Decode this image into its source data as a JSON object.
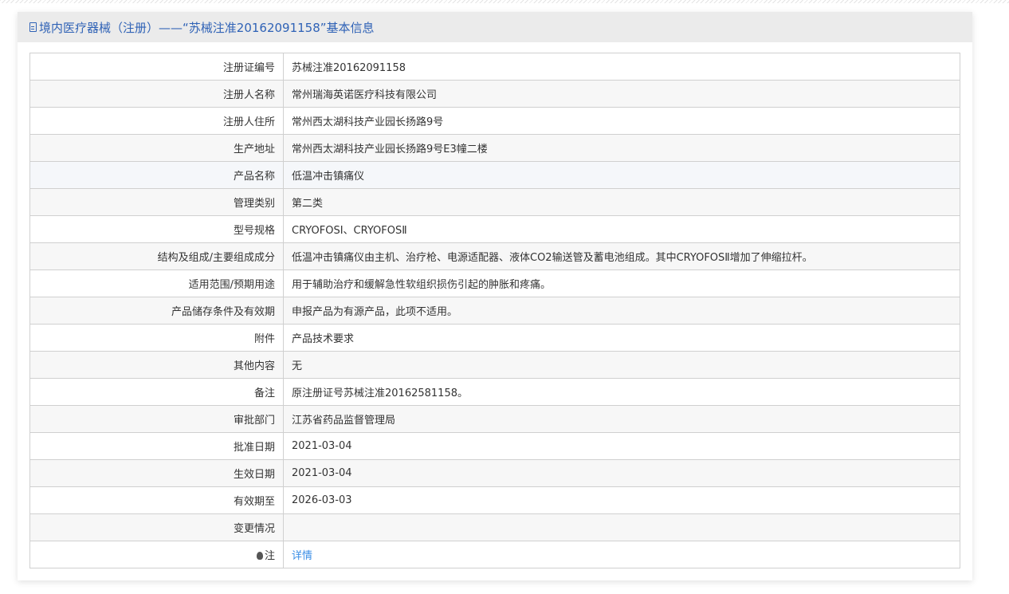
{
  "header": {
    "title": "境内医疗器械（注册）——“苏械注准20162091158”基本信息"
  },
  "rows": [
    {
      "label": "注册证编号",
      "value": "苏械注准20162091158"
    },
    {
      "label": "注册人名称",
      "value": "常州瑞海英诺医疗科技有限公司"
    },
    {
      "label": "注册人住所",
      "value": "常州西太湖科技产业园长扬路9号"
    },
    {
      "label": "生产地址",
      "value": "常州西太湖科技产业园长扬路9号E3幢二楼"
    },
    {
      "label": "产品名称",
      "value": "低温冲击镇痛仪"
    },
    {
      "label": "管理类别",
      "value": "第二类"
    },
    {
      "label": "型号规格",
      "value": "CRYOFOSⅠ、CRYOFOSⅡ"
    },
    {
      "label": "结构及组成/主要组成成分",
      "value": "低温冲击镇痛仪由主机、治疗枪、电源适配器、液体CO2输送管及蓄电池组成。其中CRYOFOSⅡ增加了伸缩拉杆。"
    },
    {
      "label": "适用范围/预期用途",
      "value": "用于辅助治疗和缓解急性软组织损伤引起的肿胀和疼痛。"
    },
    {
      "label": "产品储存条件及有效期",
      "value": "申报产品为有源产品，此项不适用。"
    },
    {
      "label": "附件",
      "value": "产品技术要求"
    },
    {
      "label": "其他内容",
      "value": "无"
    },
    {
      "label": "备注",
      "value": "原注册证号苏械注准20162581158。"
    },
    {
      "label": "审批部门",
      "value": "江苏省药品监督管理局"
    },
    {
      "label": "批准日期",
      "value": "2021-03-04"
    },
    {
      "label": "生效日期",
      "value": "2021-03-04"
    },
    {
      "label": "有效期至",
      "value": "2026-03-03"
    },
    {
      "label": "变更情况",
      "value": ""
    }
  ],
  "note": {
    "label": "注",
    "link": "详情"
  }
}
